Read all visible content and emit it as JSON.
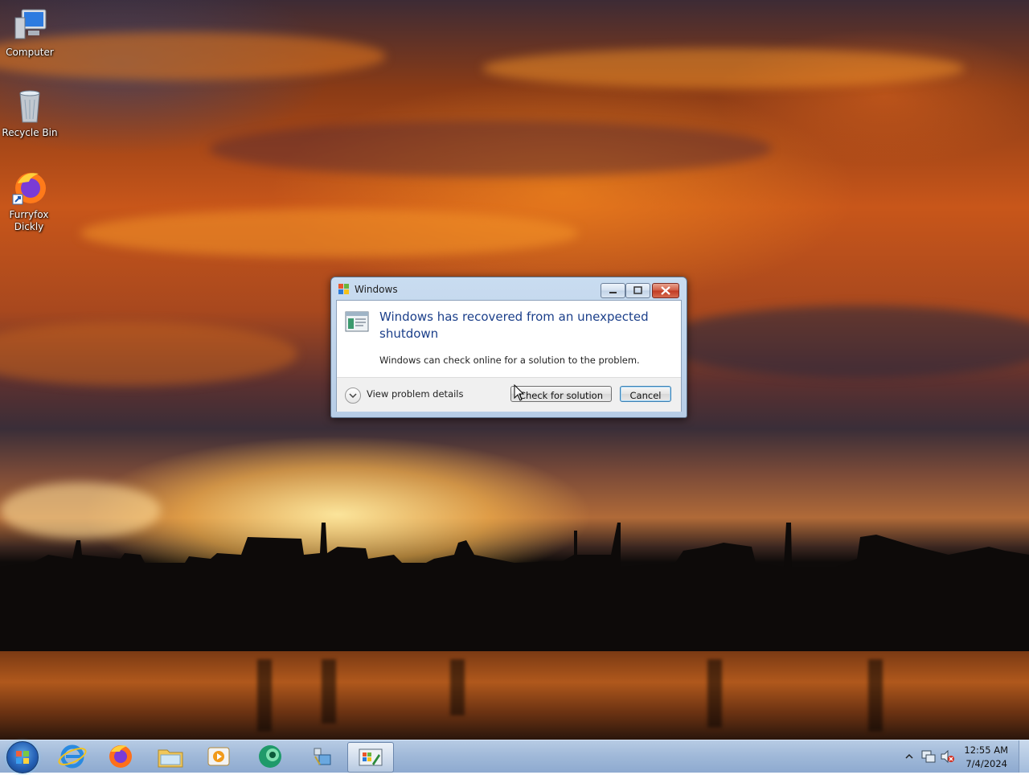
{
  "desktop": {
    "icons": [
      {
        "label": "Computer",
        "icon": "computer-icon"
      },
      {
        "label": "Recycle Bin",
        "icon": "recycle-bin-icon"
      },
      {
        "label": "Furryfox Dickly",
        "icon": "firefox-shortcut-icon"
      }
    ]
  },
  "dialog": {
    "title": "Windows",
    "main_instruction": "Windows has recovered from an unexpected shutdown",
    "content": "Windows can check online for a solution to the problem.",
    "details_label": "View problem details",
    "check_button": "Check for solution",
    "cancel_button": "Cancel"
  },
  "taskbar": {
    "pinned": [
      {
        "name": "internet-explorer-icon"
      },
      {
        "name": "firefox-icon"
      },
      {
        "name": "file-explorer-icon"
      },
      {
        "name": "media-player-icon"
      },
      {
        "name": "green-app-icon"
      },
      {
        "name": "program-icon"
      },
      {
        "name": "windows-dialog-icon"
      }
    ],
    "clock": {
      "time": "12:55 AM",
      "date": "7/4/2024"
    }
  },
  "colors": {
    "instruction_text": "#1b3f8a",
    "taskbar": "#9fb8d8",
    "close_button": "#c13a22"
  }
}
